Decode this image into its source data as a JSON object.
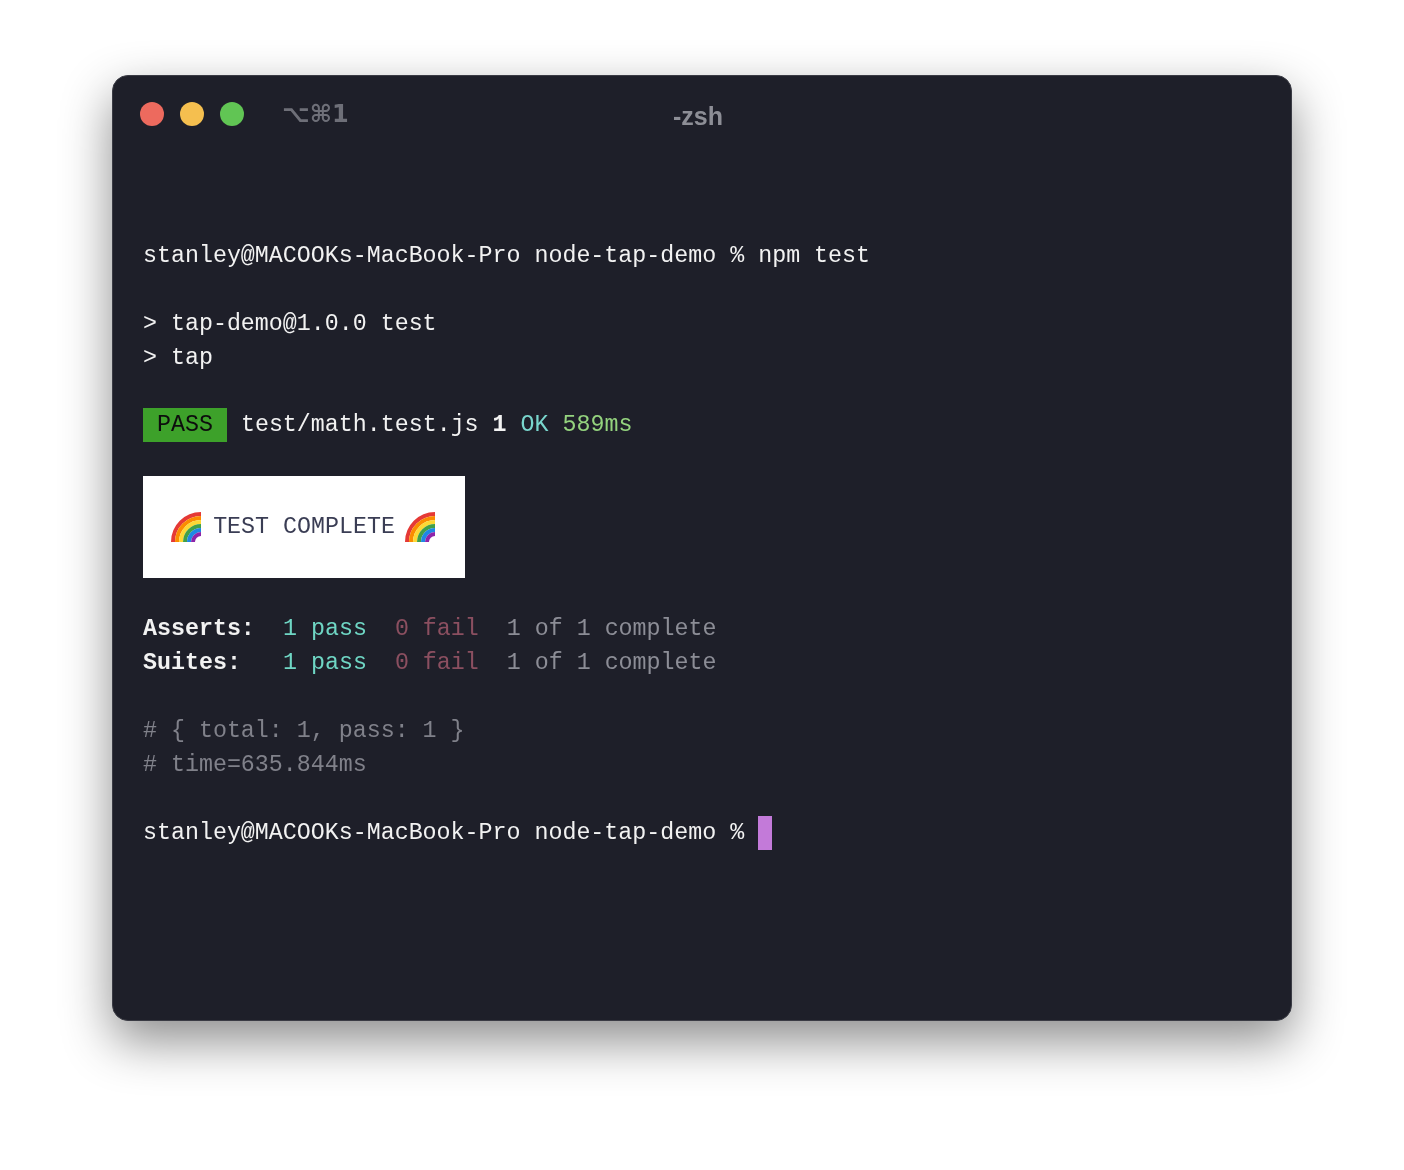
{
  "window": {
    "shortcut": "⌥⌘1",
    "title": "-zsh"
  },
  "prompt": {
    "text": "stanley@MACOOKs-MacBook-Pro node-tap-demo %",
    "command": "npm test"
  },
  "script_lines": [
    "> tap-demo@1.0.0 test",
    "> tap"
  ],
  "result": {
    "badge": "PASS",
    "file": "test/math.test.js",
    "count": "1",
    "status": "OK",
    "duration": "589ms"
  },
  "banner": "TEST COMPLETE",
  "summary": [
    {
      "label": "Asserts:",
      "pass": "1 pass",
      "fail": "0 fail",
      "complete": "1 of 1 complete"
    },
    {
      "label": "Suites:",
      "pass": "1 pass",
      "fail": "0 fail",
      "complete": "1 of 1 complete"
    }
  ],
  "comments": [
    "# { total: 1, pass: 1 }",
    "# time=635.844ms"
  ],
  "final_prompt": {
    "text": "stanley@MACOOKs-MacBook-Pro node-tap-demo %"
  }
}
